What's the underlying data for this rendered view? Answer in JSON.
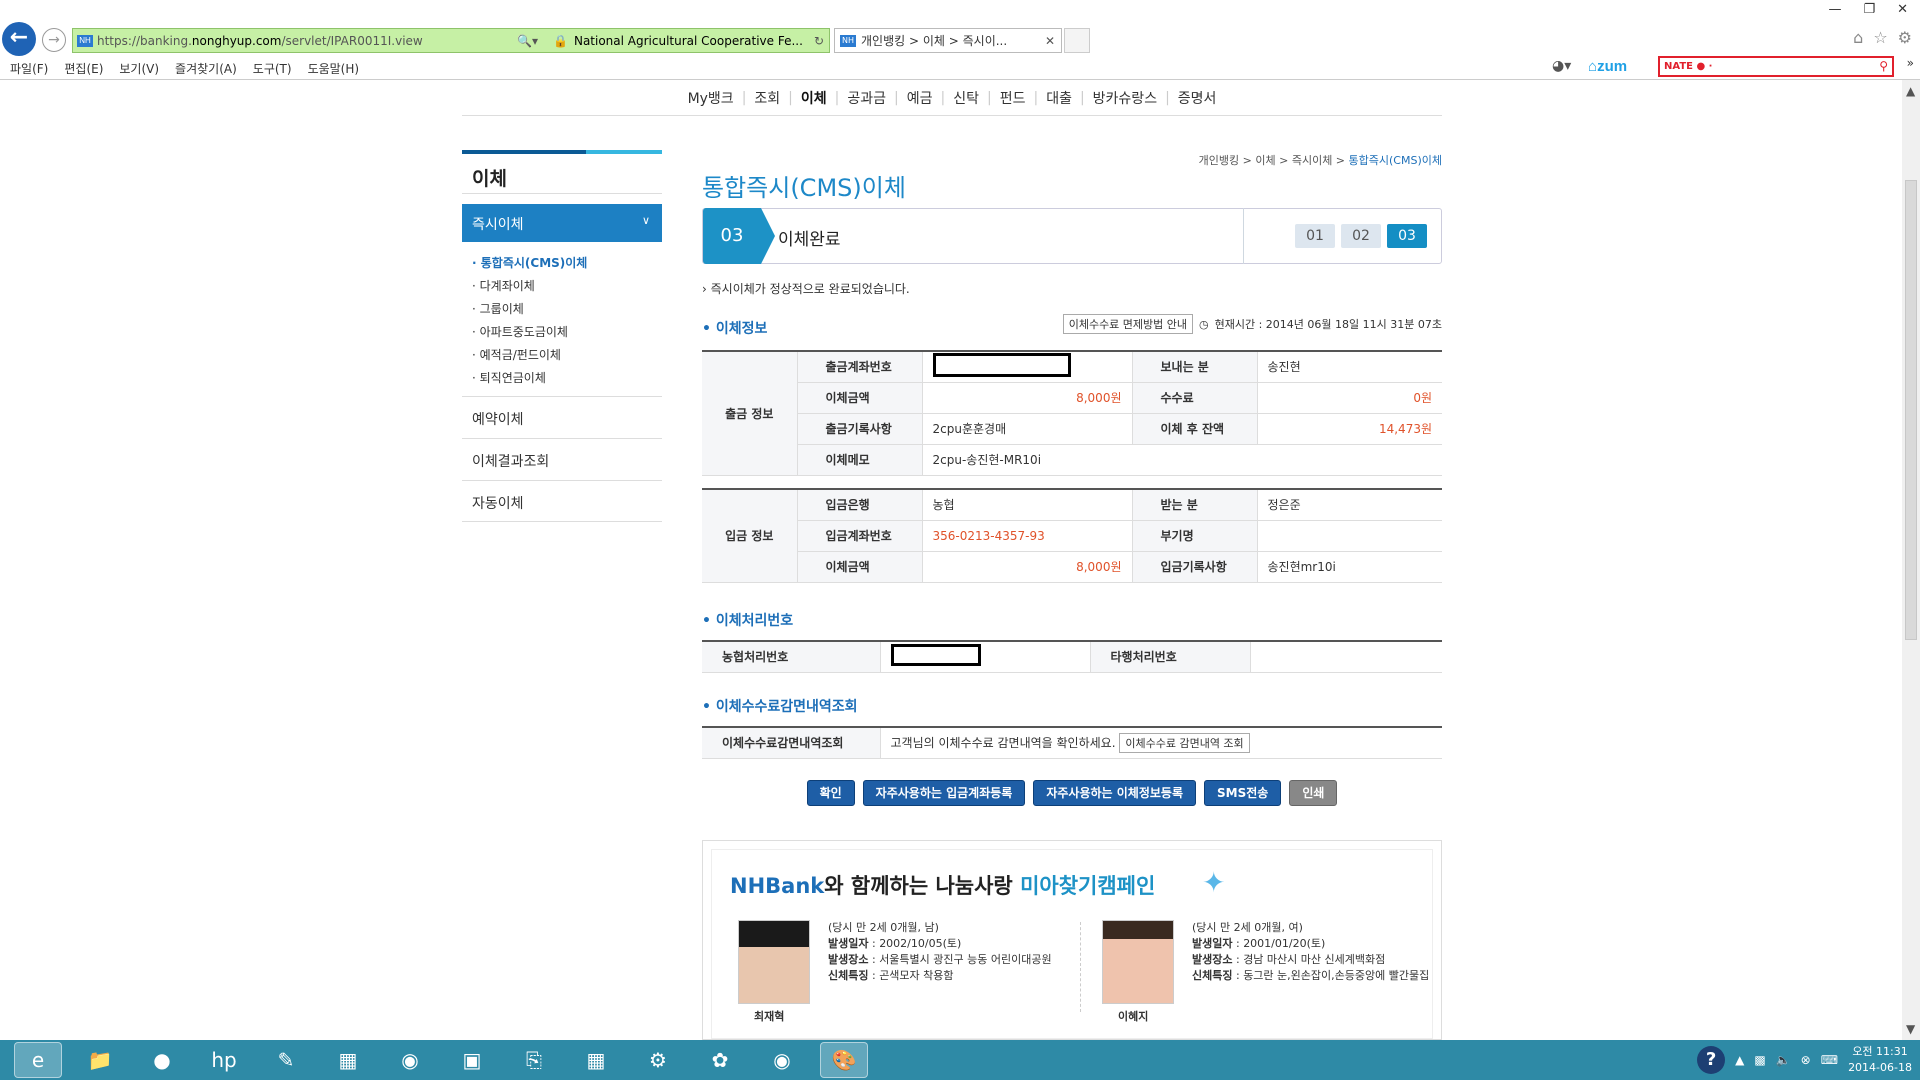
{
  "browser": {
    "url_prefix": "https://banking.",
    "url_host": "nonghyup.com",
    "url_path": "/servlet/IPAR0011I.view",
    "site_identity": "National Agricultural Cooperative Fe...",
    "tab_title": "개인뱅킹 > 이체 > 즉시이...",
    "menu": [
      "파일(F)",
      "편집(E)",
      "보기(V)",
      "즐겨찾기(A)",
      "도구(T)",
      "도움말(H)"
    ],
    "zum_label": "zum",
    "nate_label": "NATE"
  },
  "gnb": [
    "My뱅크",
    "조회",
    "이체",
    "공과금",
    "예금",
    "신탁",
    "펀드",
    "대출",
    "방카슈랑스",
    "증명서"
  ],
  "sidebar": {
    "title": "이체",
    "active_menu": "즉시이체",
    "submenu": [
      "· 통합즉시(CMS)이체",
      "· 다계좌이체",
      "· 그룹이체",
      "· 아파트중도금이체",
      "· 예적금/펀드이체",
      "· 퇴직연금이체"
    ],
    "menus": [
      "예약이체",
      "이체결과조회",
      "자동이체"
    ]
  },
  "breadcrumb": {
    "a": "개인뱅킹",
    "b": "이체",
    "c": "즉시이체",
    "d": "통합즉시(CMS)이체"
  },
  "page_title": "통합즉시(CMS)이체",
  "step": {
    "number": "03",
    "label": "이체완료",
    "pills": [
      "01",
      "02",
      "03"
    ]
  },
  "message": "즉시이체가 정상적으로 완료되었습니다.",
  "info": {
    "section": "이체정보",
    "fee_guide_button": "이체수수료 면제방법 안내",
    "current_time": "현재시간 : 2014년 06월 18일 11시 31분 07초",
    "out_group": "출금 정보",
    "out_account_label": "출금계좌번호",
    "sender_label": "보내는 분",
    "sender": "송진현",
    "amount_label": "이체금액",
    "amount": "8,000원",
    "fee_label": "수수료",
    "fee": "0원",
    "out_record_label": "출금기록사항",
    "out_record": "2cpu훈훈경매",
    "balance_label": "이체 후 잔액",
    "balance": "14,473원",
    "memo_label": "이체메모",
    "memo": "2cpu-송진현-MR10i",
    "in_group": "입금 정보",
    "in_bank_label": "입금은행",
    "in_bank": "농협",
    "receiver_label": "받는 분",
    "receiver": "정은준",
    "in_account_label": "입금계좌번호",
    "in_account": "356-0213-4357-93",
    "cms_label": "부기명",
    "cms": "",
    "in_amount_label": "이체금액",
    "in_amount": "8,000원",
    "in_record_label": "입금기록사항",
    "in_record": "송진현mr10i"
  },
  "processing": {
    "section": "이체처리번호",
    "nh_label": "농협처리번호",
    "other_label": "타행처리번호",
    "other_value": ""
  },
  "fee_lookup": {
    "section": "이체수수료감면내역조회",
    "label": "이체수수료감면내역조회",
    "text": "고객님의 이체수수료 감면내역을 확인하세요.",
    "button": "이체수수료 감면내역 조회"
  },
  "buttons": [
    "확인",
    "자주사용하는 입금계좌등록",
    "자주사용하는 이체정보등록",
    "SMS전송",
    "인쇄"
  ],
  "banner": {
    "title_a": "NHBank",
    "title_b": "와 함께하는 나눔사랑 ",
    "title_c": "미아찾기캠페인",
    "kid1": {
      "age": "(당시 만 2세 0개월, 남)",
      "date_label": "발생일자",
      "date": "2002/10/05(토)",
      "place_label": "발생장소",
      "place": "서울특별시 광진구 능동 어린이대공원",
      "feature_label": "신체특징",
      "feature": "곤색모자 착용함",
      "name": "최재혁"
    },
    "kid2": {
      "age": "(당시 만 2세 0개월, 여)",
      "date_label": "발생일자",
      "date": "2001/01/20(토)",
      "place_label": "발생장소",
      "place": "경남 마산시 마산 신세계백화점",
      "feature_label": "신체특징",
      "feature": "동그란 눈,왼손잡이,손등중앙에 빨간물집",
      "name": "이혜지"
    }
  },
  "taskbar": {
    "time": "오전 11:31",
    "date": "2014-06-18"
  }
}
